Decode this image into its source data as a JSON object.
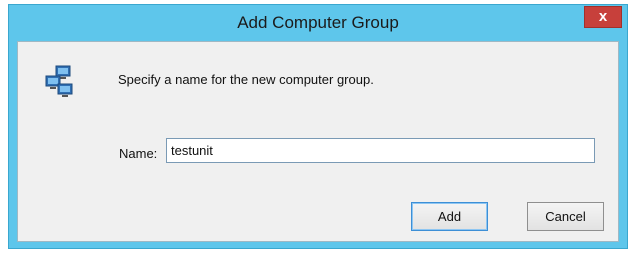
{
  "dialog": {
    "title": "Add Computer Group",
    "close_label": "x",
    "instruction": "Specify a name for the new computer group.",
    "name_label": "Name:",
    "name_value": "testunit",
    "add_label": "Add",
    "cancel_label": "Cancel",
    "icon": "computer-group-icon"
  },
  "colors": {
    "titlebar": "#5ec6eb",
    "close_button": "#c7403b",
    "client_background": "#f0f0f0"
  }
}
